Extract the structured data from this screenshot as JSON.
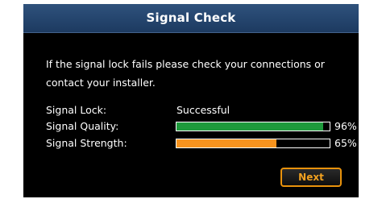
{
  "dialog": {
    "title": "Signal Check",
    "message": "If the signal lock fails please check your connections or contact your installer."
  },
  "signal_lock": {
    "label": "Signal Lock:",
    "value": "Successful"
  },
  "signal_quality": {
    "label": "Signal Quality:",
    "level": 0.96,
    "percent_text": "96%",
    "color": "#1e9a3c"
  },
  "signal_strength": {
    "label": "Signal Strength:",
    "level": 0.65,
    "percent_text": "65%",
    "color": "#f7931e"
  },
  "actions": {
    "next_label": "Next"
  }
}
